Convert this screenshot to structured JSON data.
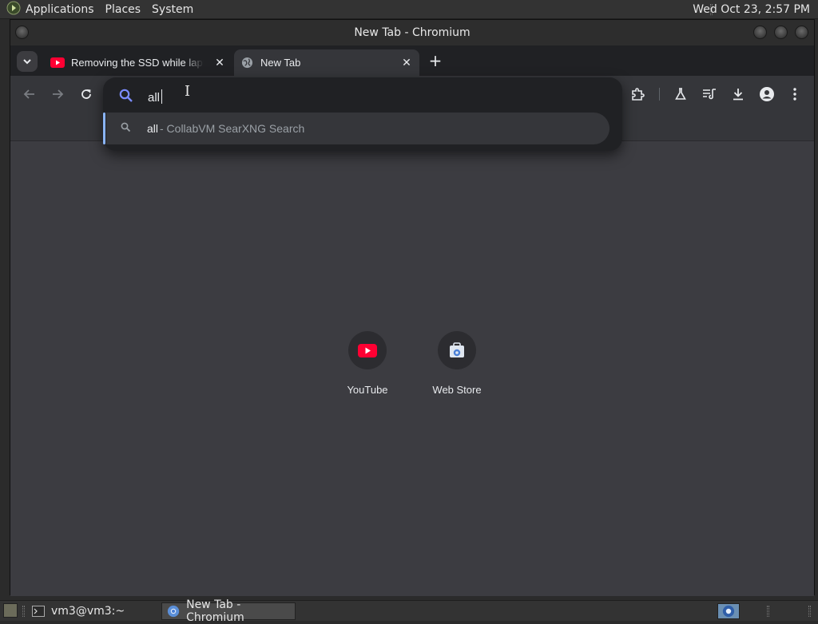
{
  "desktop": {
    "menus": [
      "Applications",
      "Places",
      "System"
    ],
    "clock": "Wed Oct 23,  2:57 PM"
  },
  "window": {
    "title": "New Tab - Chromium"
  },
  "tabs": [
    {
      "title": "Removing the SSD while laptop",
      "favicon": "youtube-icon",
      "active": false
    },
    {
      "title": "New Tab",
      "favicon": "globe-icon",
      "active": true
    }
  ],
  "omnibox": {
    "query": "all",
    "suggestion": {
      "query": "all",
      "engine": " - CollabVM SearXNG Search"
    }
  },
  "shortcuts": [
    {
      "label": "YouTube",
      "icon": "youtube-icon"
    },
    {
      "label": "Web Store",
      "icon": "web-store-icon"
    }
  ],
  "taskbar": {
    "items": [
      {
        "label": "vm3@vm3:~",
        "icon": "terminal-icon"
      },
      {
        "label": "New Tab - Chromium",
        "icon": "chromium-icon",
        "active": true
      }
    ]
  },
  "colors": {
    "accent": "#8ab4f8",
    "search_icon": "#7b8cff",
    "youtube_red": "#ff0033",
    "content_bg": "#3c3c41",
    "toolbar_bg": "#35363a"
  }
}
